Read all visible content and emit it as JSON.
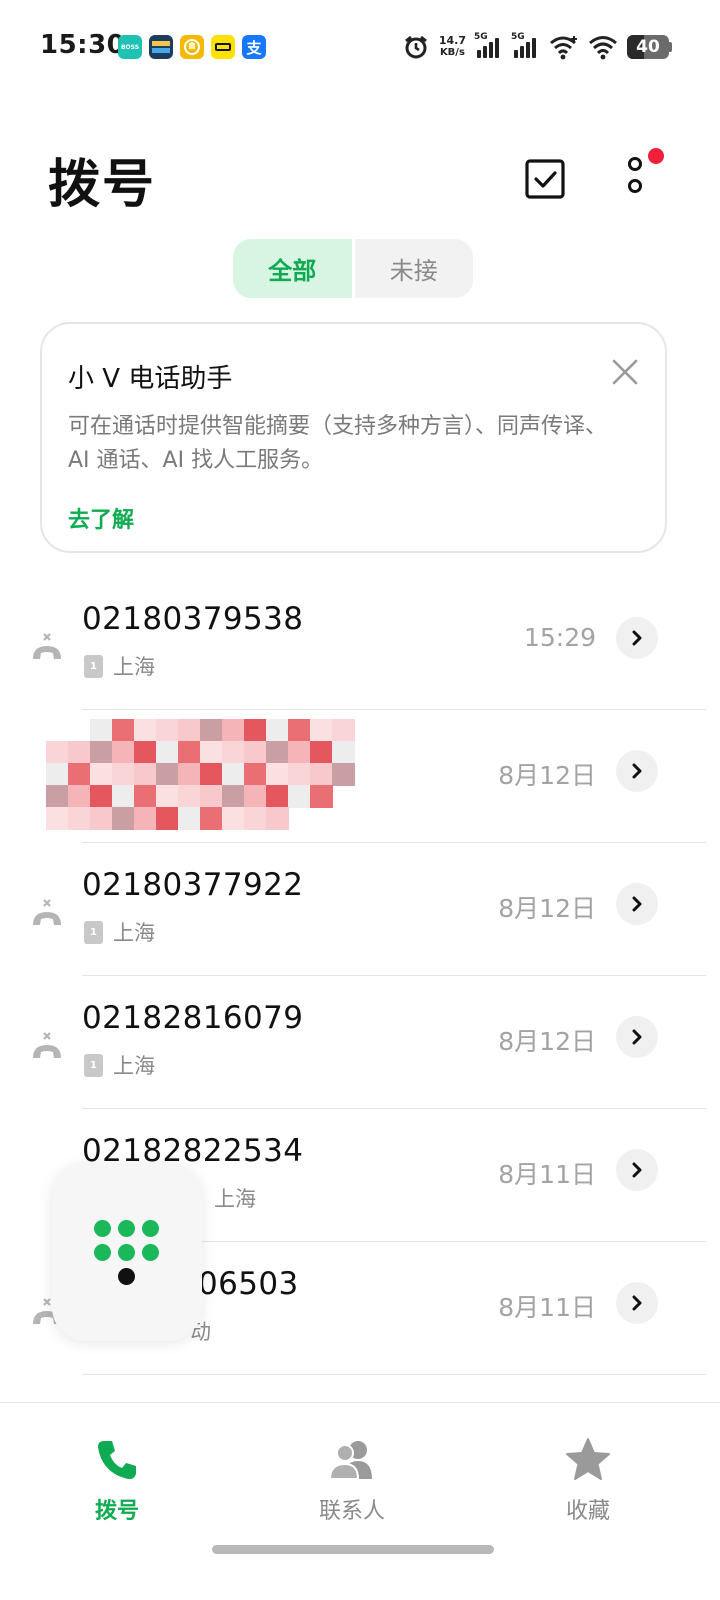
{
  "status_bar": {
    "time": "15:30",
    "app_icons": [
      {
        "name": "boss-icon",
        "label": "BOSS",
        "color": "#1fc1b4"
      },
      {
        "name": "game-app-icon",
        "label": "",
        "color": "#1b3d5e"
      },
      {
        "name": "hand-app-icon",
        "label": "",
        "color": "#f5b900"
      },
      {
        "name": "xianyu-icon",
        "label": "",
        "color": "#ffe100"
      },
      {
        "name": "alipay-icon",
        "label": "支",
        "color": "#1677ff"
      }
    ],
    "net_speed_value": "14.7",
    "net_speed_unit": "KB/s",
    "sim1_label": "5G",
    "sim2_label": "5G",
    "battery_level": "40",
    "battery_fraction": 0.4
  },
  "header": {
    "title": "拨号"
  },
  "filter_tabs": [
    {
      "label": "全部",
      "active": true
    },
    {
      "label": "未接",
      "active": false
    }
  ],
  "promo": {
    "title": "小 V 电话助手",
    "description": "可在通话时提供智能摘要（支持多种方言）、同声传译、AI 通话、AI 找人工服务。",
    "link": "去了解"
  },
  "calls": [
    {
      "number": "02180379538",
      "location": "上海",
      "time": "15:29",
      "missed": true
    },
    {
      "number": "",
      "location": "",
      "time": "8月12日",
      "missed": false,
      "redacted": true
    },
    {
      "number": "02180377922",
      "location": "上海",
      "time": "8月12日",
      "missed": true
    },
    {
      "number": "02182816079",
      "location": "上海",
      "time": "8月12日",
      "missed": true
    },
    {
      "number": "02182822534",
      "location": "上海",
      "time": "8月11日",
      "missed": false
    },
    {
      "number": "06503",
      "location": "动",
      "time": "8月11日",
      "missed": true
    }
  ],
  "bottom_nav": [
    {
      "label": "拨号",
      "active": true
    },
    {
      "label": "联系人",
      "active": false
    },
    {
      "label": "收藏",
      "active": false
    }
  ],
  "colors": {
    "accent": "#0fab52",
    "badge_red": "#f0213a"
  }
}
